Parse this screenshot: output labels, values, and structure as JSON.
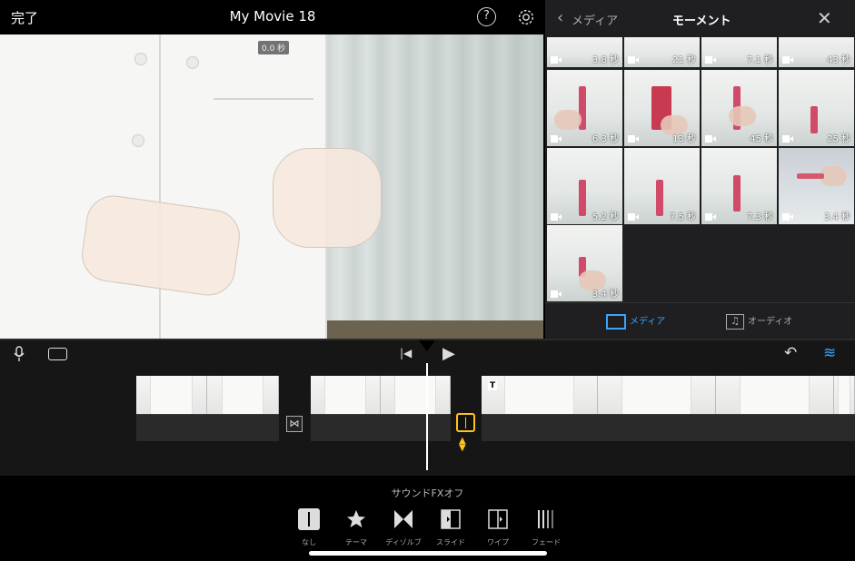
{
  "topbar": {
    "done_label": "完了",
    "project_title": "My Movie 18",
    "help_label": "?"
  },
  "viewer": {
    "timestamp": "0.0 秒"
  },
  "browser": {
    "back_label": "メディア",
    "title": "モーメント",
    "clips": [
      {
        "duration": "3.8 秒"
      },
      {
        "duration": "21 秒"
      },
      {
        "duration": "7.1 秒"
      },
      {
        "duration": "43 秒"
      },
      {
        "duration": "6.3 秒"
      },
      {
        "duration": "13 秒"
      },
      {
        "duration": "45 秒"
      },
      {
        "duration": "25 秒"
      },
      {
        "duration": "5.2 秒"
      },
      {
        "duration": "7.5 秒"
      },
      {
        "duration": "7.3 秒"
      },
      {
        "duration": "3.4 秒"
      },
      {
        "duration": "3.4 秒"
      }
    ],
    "tab_media": "メディア",
    "tab_audio": "オーディオ"
  },
  "inspector": {
    "sound_fx": "サウンドFXオフ",
    "options": [
      {
        "label": "なし",
        "icon": "none-transition-icon",
        "selected": true
      },
      {
        "label": "テーマ",
        "icon": "star-icon",
        "selected": false
      },
      {
        "label": "ディゾルブ",
        "icon": "dissolve-icon",
        "selected": false
      },
      {
        "label": "スライド",
        "icon": "slide-icon",
        "selected": false
      },
      {
        "label": "ワイプ",
        "icon": "wipe-icon",
        "selected": false
      },
      {
        "label": "フェード",
        "icon": "fade-icon",
        "selected": false
      }
    ]
  },
  "colors": {
    "accent_blue": "#3aa3ff",
    "selection_yellow": "#ffc21c"
  }
}
